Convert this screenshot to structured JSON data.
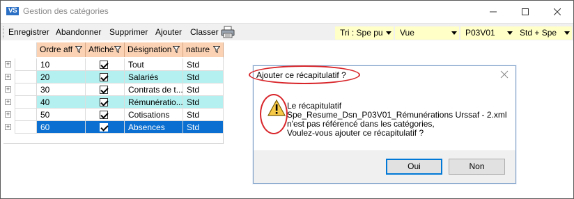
{
  "window": {
    "logo_text": "VS",
    "title": "Gestion des catégories"
  },
  "toolbar": {
    "enregistrer": "Enregistrer",
    "abandonner": "Abandonner",
    "supprimer": "Supprimer",
    "ajouter": "Ajouter",
    "classer": "Classer",
    "print_icon": "printer-icon",
    "combos": [
      {
        "value": "Tri : Spe pu"
      },
      {
        "value": "Vue"
      },
      {
        "value": "P03V01"
      },
      {
        "value": "Std + Spe"
      }
    ]
  },
  "grid": {
    "columns": [
      "Ordre aff",
      "Affiché",
      "Désignation",
      "nature"
    ],
    "rows": [
      {
        "ordre": "10",
        "affiche": true,
        "designation": "Tout",
        "nature": "Std",
        "style": "normal"
      },
      {
        "ordre": "20",
        "affiche": true,
        "designation": "Salariés",
        "nature": "Std",
        "style": "cyan"
      },
      {
        "ordre": "30",
        "affiche": true,
        "designation": "Contrats de t...",
        "nature": "Std",
        "style": "normal"
      },
      {
        "ordre": "40",
        "affiche": true,
        "designation": "Rémunératio...",
        "nature": "Std",
        "style": "cyan"
      },
      {
        "ordre": "50",
        "affiche": true,
        "designation": "Cotisations",
        "nature": "Std",
        "style": "normal"
      },
      {
        "ordre": "60",
        "affiche": true,
        "designation": "Absences",
        "nature": "Std",
        "style": "selected"
      }
    ]
  },
  "dialog": {
    "title": "Ajouter ce récapitulatif ?",
    "message_lines": [
      "Le récapitulatif",
      "Spe_Resume_Dsn_P03V01_Rémunérations Urssaf - 2.xml",
      "n'est pas référencé dans les catégories,",
      "Voulez-vous ajouter ce récapitulatif ?"
    ],
    "yes_label": "Oui",
    "no_label": "Non",
    "icon": "warning-icon"
  },
  "colors": {
    "header_bg": "#fbd2b4",
    "cyan_row": "#b4f0f0",
    "selected_row": "#0a6fd1",
    "combo_bg": "#ffffc8",
    "annotation_red": "#d8252a"
  }
}
